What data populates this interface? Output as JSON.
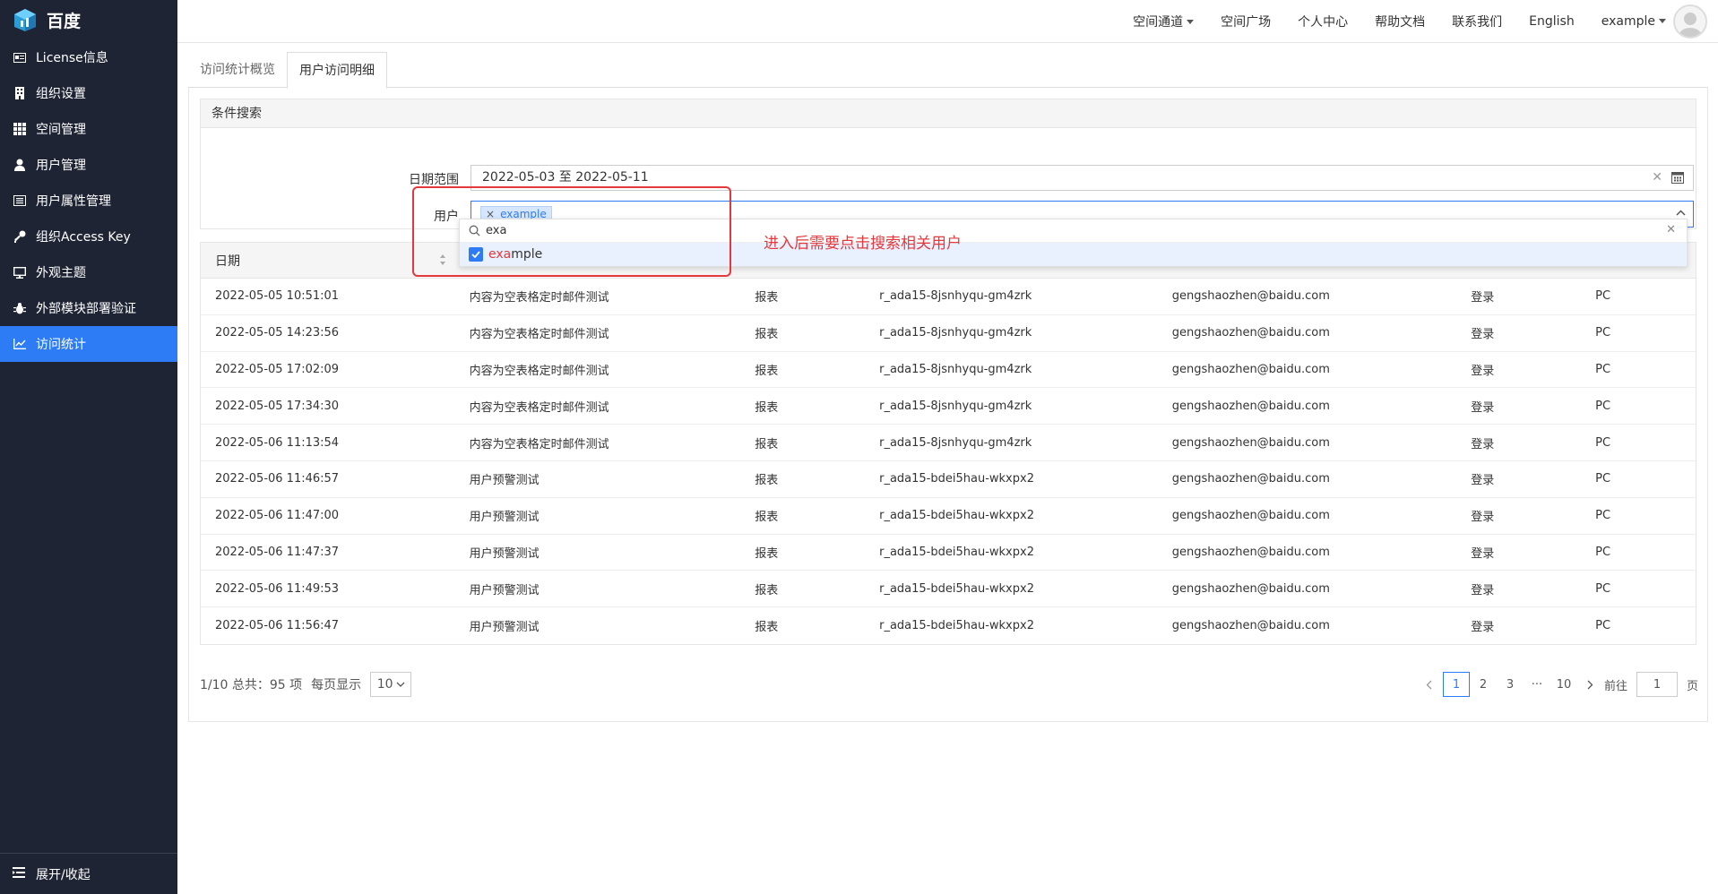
{
  "brand": {
    "name": "百度"
  },
  "sidebar": {
    "items": [
      {
        "label": "License信息",
        "icon": "license-icon"
      },
      {
        "label": "组织设置",
        "icon": "building-icon"
      },
      {
        "label": "空间管理",
        "icon": "grid-icon"
      },
      {
        "label": "用户管理",
        "icon": "user-icon"
      },
      {
        "label": "用户属性管理",
        "icon": "list-icon"
      },
      {
        "label": "组织Access Key",
        "icon": "key-icon"
      },
      {
        "label": "外观主题",
        "icon": "monitor-icon"
      },
      {
        "label": "外部模块部署验证",
        "icon": "bug-icon"
      },
      {
        "label": "访问统计",
        "icon": "chart-icon",
        "active": true
      }
    ],
    "collapse_label": "展开/收起"
  },
  "topbar": {
    "links": [
      "空间通道",
      "空间广场",
      "个人中心",
      "帮助文档",
      "联系我们",
      "English"
    ],
    "user": "example"
  },
  "tabs": [
    "访问统计概览",
    "用户访问明细"
  ],
  "search": {
    "title": "条件搜索",
    "date_label": "日期范围",
    "date_value": "2022-05-03 至 2022-05-11",
    "user_label": "用户",
    "user_tag": "example",
    "dropdown_query": "exa",
    "option_match": "exa",
    "option_rest": "mple"
  },
  "annotation": "进入后需要点击搜索相关用户",
  "table": {
    "header_date": "日期",
    "rows": [
      [
        "2022-05-05 10:51:01",
        "内容为空表格定时邮件测试",
        "报表",
        "r_ada15-8jsnhyqu-gm4zrk",
        "gengshaozhen@baidu.com",
        "登录",
        "PC"
      ],
      [
        "2022-05-05 14:23:56",
        "内容为空表格定时邮件测试",
        "报表",
        "r_ada15-8jsnhyqu-gm4zrk",
        "gengshaozhen@baidu.com",
        "登录",
        "PC"
      ],
      [
        "2022-05-05 17:02:09",
        "内容为空表格定时邮件测试",
        "报表",
        "r_ada15-8jsnhyqu-gm4zrk",
        "gengshaozhen@baidu.com",
        "登录",
        "PC"
      ],
      [
        "2022-05-05 17:34:30",
        "内容为空表格定时邮件测试",
        "报表",
        "r_ada15-8jsnhyqu-gm4zrk",
        "gengshaozhen@baidu.com",
        "登录",
        "PC"
      ],
      [
        "2022-05-06 11:13:54",
        "内容为空表格定时邮件测试",
        "报表",
        "r_ada15-8jsnhyqu-gm4zrk",
        "gengshaozhen@baidu.com",
        "登录",
        "PC"
      ],
      [
        "2022-05-06 11:46:57",
        "用户预警测试",
        "报表",
        "r_ada15-bdei5hau-wkxpx2",
        "gengshaozhen@baidu.com",
        "登录",
        "PC"
      ],
      [
        "2022-05-06 11:47:00",
        "用户预警测试",
        "报表",
        "r_ada15-bdei5hau-wkxpx2",
        "gengshaozhen@baidu.com",
        "登录",
        "PC"
      ],
      [
        "2022-05-06 11:47:37",
        "用户预警测试",
        "报表",
        "r_ada15-bdei5hau-wkxpx2",
        "gengshaozhen@baidu.com",
        "登录",
        "PC"
      ],
      [
        "2022-05-06 11:49:53",
        "用户预警测试",
        "报表",
        "r_ada15-bdei5hau-wkxpx2",
        "gengshaozhen@baidu.com",
        "登录",
        "PC"
      ],
      [
        "2022-05-06 11:56:47",
        "用户预警测试",
        "报表",
        "r_ada15-bdei5hau-wkxpx2",
        "gengshaozhen@baidu.com",
        "登录",
        "PC"
      ]
    ]
  },
  "pagination": {
    "summary": "1/10 总共：95 项",
    "per_page_label": "每页显示",
    "page_size": "10",
    "pages": [
      "1",
      "2",
      "3",
      "···",
      "10"
    ],
    "goto_label": "前往",
    "goto_value": "1",
    "page_suffix": "页"
  },
  "colors": {
    "sidebar_bg": "#1f2434",
    "accent": "#2d7cf6",
    "annotation": "#e4393c"
  }
}
